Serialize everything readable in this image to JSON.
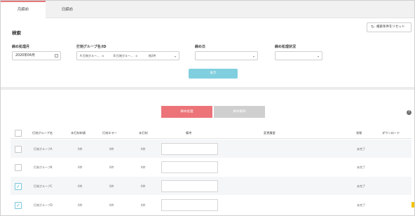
{
  "tabs": [
    {
      "label": "月締め",
      "active": true
    },
    {
      "label": "日締め",
      "active": false
    }
  ],
  "search": {
    "title": "検索",
    "reset_label": "検索条件をリセット",
    "fields": {
      "period_label": "締め処理月",
      "period_value": "2020年04月",
      "group_label": "打刻グループ名/ID",
      "group_tags": [
        "A 打刻グルー…",
        "B 打刻グルー…"
      ],
      "group_more": "他2件",
      "closing_day_label": "締め日",
      "closing_status_label": "締め処理状況"
    },
    "display_label": "表示"
  },
  "actions": {
    "close_label": "締め処理",
    "cancel_label": "締め解除",
    "help_icon": "?"
  },
  "table": {
    "headers": [
      "打刻グループ名",
      "未打刻申請",
      "打刻エラー",
      "未打刻",
      "備考",
      "変更履歴",
      "状態",
      "ダウンロード"
    ],
    "rows": [
      {
        "name": "打刻グループA",
        "c1": "0件",
        "c2": "0件",
        "c3": "0件",
        "status": "未完了",
        "checked": false
      },
      {
        "name": "打刻グループB",
        "c1": "0件",
        "c2": "0件",
        "c3": "0件",
        "status": "未完了",
        "checked": false
      },
      {
        "name": "打刻グループC",
        "c1": "0件",
        "c2": "0件",
        "c3": "0件",
        "status": "未完了",
        "checked": true
      },
      {
        "name": "打刻グループD",
        "c1": "0件",
        "c2": "0件",
        "c3": "0件",
        "status": "未完了",
        "checked": true
      }
    ]
  }
}
